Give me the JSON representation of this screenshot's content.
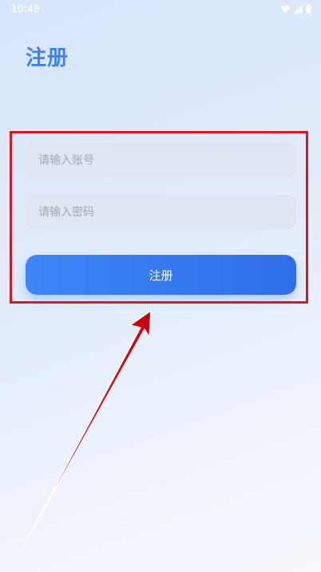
{
  "status_bar": {
    "time": "10:48",
    "icons": [
      "wifi-icon",
      "signal-icon",
      "battery-icon"
    ]
  },
  "header": {
    "title": "注册"
  },
  "form": {
    "account_placeholder": "请输入账号",
    "password_placeholder": "请输入密码",
    "submit_label": "注册"
  },
  "colors": {
    "accent": "#3b82f6",
    "button": "#3d86f7",
    "input_background": "#dfe6f1",
    "annotation": "#e0161e"
  }
}
